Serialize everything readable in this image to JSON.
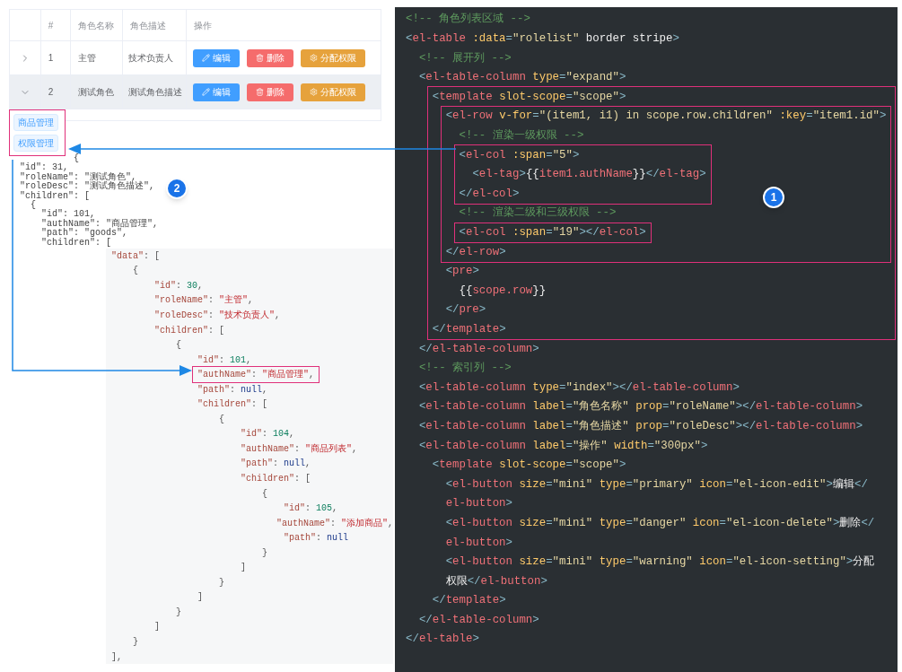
{
  "roles_table": {
    "columns": [
      {
        "label": "#"
      },
      {
        "label": "角色名称"
      },
      {
        "label": "角色描述"
      },
      {
        "label": "操作"
      }
    ],
    "rows": [
      {
        "expanded": false,
        "highlighted": false,
        "index": "1",
        "name": "主管",
        "desc": "技术负责人",
        "actions": [
          {
            "kind": "primary",
            "label": "编辑"
          },
          {
            "kind": "danger",
            "label": "删除"
          },
          {
            "kind": "warning",
            "label": "分配权限"
          }
        ]
      },
      {
        "expanded": true,
        "highlighted": true,
        "index": "2",
        "name": "测试角色",
        "desc": "测试角色描述",
        "actions": [
          {
            "kind": "primary",
            "label": "编辑"
          },
          {
            "kind": "danger",
            "label": "删除"
          },
          {
            "kind": "warning",
            "label": "分配权限"
          }
        ]
      }
    ]
  },
  "expanded_tags": {
    "highlighted": true,
    "tags": [
      "商品管理",
      "权限管理"
    ]
  },
  "row_dump": {
    "badge": "2",
    "lines": [
      "          {",
      "\"id\": 31,",
      "\"roleName\": \"测试角色\",",
      "\"roleDesc\": \"测试角色描述\",",
      "\"children\": [",
      "  {",
      "    \"id\": 101,",
      "    \"authName\": \"商品管理\",",
      "    \"path\": \"goods\",",
      "    \"children\": ["
    ]
  },
  "response_json": {
    "lines": [
      {
        "kind": "code",
        "text": "\"data\": ["
      },
      {
        "kind": "code",
        "text": "    {"
      },
      {
        "kind": "code",
        "text": "        \"id\": 30,"
      },
      {
        "kind": "code",
        "text": "        \"roleName\": \"主管\","
      },
      {
        "kind": "code",
        "text": "        \"roleDesc\": \"技术负责人\","
      },
      {
        "kind": "code",
        "text": "        \"children\": ["
      },
      {
        "kind": "code",
        "text": "            {"
      },
      {
        "kind": "code",
        "text": "                \"id\": 101,"
      },
      {
        "kind": "highlight",
        "children": [
          {
            "kind": "code",
            "text": "                \"authName\": \"商品管理\","
          }
        ]
      },
      {
        "kind": "code",
        "text": "                \"path\": null,"
      },
      {
        "kind": "code",
        "text": "                \"children\": ["
      },
      {
        "kind": "code",
        "text": "                    {"
      },
      {
        "kind": "code",
        "text": "                        \"id\": 104,"
      },
      {
        "kind": "code",
        "text": "                        \"authName\": \"商品列表\","
      },
      {
        "kind": "code",
        "text": "                        \"path\": null,"
      },
      {
        "kind": "code",
        "text": "                        \"children\": ["
      },
      {
        "kind": "code",
        "text": "                            {"
      },
      {
        "kind": "code",
        "text": "                                \"id\": 105,"
      },
      {
        "kind": "code",
        "text": "                                \"authName\": \"添加商品\","
      },
      {
        "kind": "code",
        "text": "                                \"path\": null"
      },
      {
        "kind": "code",
        "text": "                            }"
      },
      {
        "kind": "code",
        "text": "                        ]"
      },
      {
        "kind": "code",
        "text": "                    }"
      },
      {
        "kind": "code",
        "text": "                ]"
      },
      {
        "kind": "code",
        "text": "            }"
      },
      {
        "kind": "code",
        "text": "        ]"
      },
      {
        "kind": "code",
        "text": "    }"
      },
      {
        "kind": "code",
        "text": "],"
      }
    ]
  },
  "code_editor": {
    "badge": "1",
    "lines": [
      {
        "kind": "comment",
        "text": "<!-- 角色列表区域 -->"
      },
      {
        "kind": "code",
        "text": "<el-table :data=\"rolelist\" border stripe>"
      },
      {
        "kind": "comment",
        "text": "  <!-- 展开列 -->"
      },
      {
        "kind": "code",
        "text": "  <el-table-column type=\"expand\">"
      },
      {
        "kind": "highlight",
        "children": [
          {
            "kind": "code",
            "text": "    <template slot-scope=\"scope\">"
          },
          {
            "kind": "highlight",
            "children": [
              {
                "kind": "code",
                "text": "      <el-row v-for=\"(item1, i1) in scope.row.children\" :key=\"item1.id\">"
              },
              {
                "kind": "comment",
                "text": "        <!-- 渲染一级权限 -->"
              },
              {
                "kind": "highlight",
                "children": [
                  {
                    "kind": "code",
                    "text": "        <el-col :span=\"5\">"
                  },
                  {
                    "kind": "code",
                    "text": "          <el-tag>{{item1.authName}}</el-tag>"
                  },
                  {
                    "kind": "code",
                    "text": "        </el-col>"
                  }
                ]
              },
              {
                "kind": "comment",
                "text": "        <!-- 渲染二级和三级权限 -->"
              },
              {
                "kind": "highlight",
                "children": [
                  {
                    "kind": "code",
                    "text": "        <el-col :span=\"19\"></el-col>"
                  }
                ]
              },
              {
                "kind": "code",
                "text": "      </el-row>"
              }
            ]
          },
          {
            "kind": "code",
            "text": "      <pre>"
          },
          {
            "kind": "code",
            "text": "        {{scope.row}}"
          },
          {
            "kind": "code",
            "text": "      </pre>"
          },
          {
            "kind": "code",
            "text": "    </template>"
          }
        ]
      },
      {
        "kind": "code",
        "text": "  </el-table-column>"
      },
      {
        "kind": "comment",
        "text": "  <!-- 索引列 -->"
      },
      {
        "kind": "code",
        "text": "  <el-table-column type=\"index\"></el-table-column>"
      },
      {
        "kind": "code",
        "text": "  <el-table-column label=\"角色名称\" prop=\"roleName\"></el-table-column>"
      },
      {
        "kind": "code",
        "text": "  <el-table-column label=\"角色描述\" prop=\"roleDesc\"></el-table-column>"
      },
      {
        "kind": "code",
        "text": "  <el-table-column label=\"操作\" width=\"300px\">"
      },
      {
        "kind": "code",
        "text": "    <template slot-scope=\"scope\">"
      },
      {
        "kind": "code",
        "text": "      <el-button size=\"mini\" type=\"primary\" icon=\"el-icon-edit\">编辑</"
      },
      {
        "kind": "code",
        "text": "      el-button>"
      },
      {
        "kind": "code",
        "text": "      <el-button size=\"mini\" type=\"danger\" icon=\"el-icon-delete\">删除</"
      },
      {
        "kind": "code",
        "text": "      el-button>"
      },
      {
        "kind": "code",
        "text": "      <el-button size=\"mini\" type=\"warning\" icon=\"el-icon-setting\">分配"
      },
      {
        "kind": "code",
        "text": "      权限</el-button>"
      },
      {
        "kind": "code",
        "text": "    </template>"
      },
      {
        "kind": "code",
        "text": "  </el-table-column>"
      },
      {
        "kind": "code",
        "text": "</el-table>"
      }
    ]
  }
}
